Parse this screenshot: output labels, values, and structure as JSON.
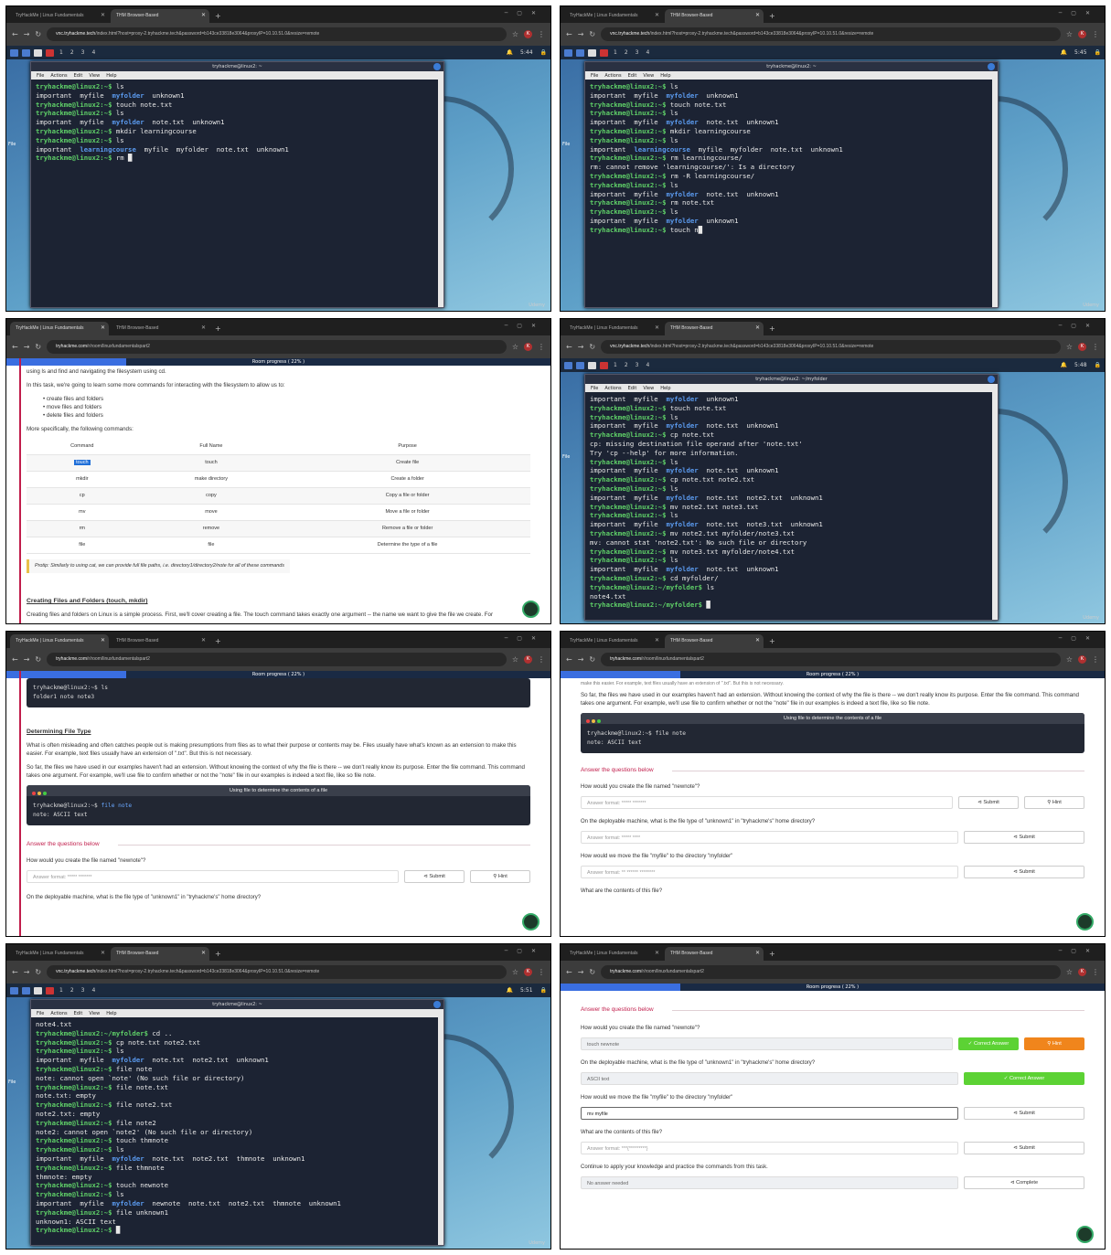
{
  "tabs": {
    "tab1": "TryHackMe | Linux Fundamentals",
    "tab2": "THM Browser-Based",
    "newtab": "+"
  },
  "urls": {
    "vnc_host": "vnc.tryhackme.tech",
    "vnc_rest": "/index.html?host=proxy-2.tryhackme.tech&password=b143ce33818e3064&proxyIP=10.10.51.0&resize=remote",
    "room_host": "tryhackme.com",
    "room_rest": "/r/room/linuxfundamentalspart2"
  },
  "avatar": "K",
  "taskbar": {
    "workspaces": [
      "1",
      "2",
      "3",
      "4"
    ],
    "times": [
      "5:44",
      "5:45",
      "5:48",
      "5:51"
    ]
  },
  "terminal": {
    "title_home": "tryhackme@linux2: ~",
    "title_folder": "tryhackme@linux2: ~/myfolder",
    "menu": [
      "File",
      "Actions",
      "Edit",
      "View",
      "Help"
    ]
  },
  "desktop_label": "File",
  "watermark": "Udemy",
  "progress": "Room progress ( 22% )",
  "term1": [
    {
      "p": "tryhackme@linux2:~$",
      "c": " ls"
    },
    {
      "t": "important  myfile  ",
      "b": "myfolder",
      "t2": "  unknown1"
    },
    {
      "p": "tryhackme@linux2:~$",
      "c": " touch note.txt"
    },
    {
      "p": "tryhackme@linux2:~$",
      "c": " ls"
    },
    {
      "t": "important  myfile  ",
      "b": "myfolder",
      "t2": "  note.txt  unknown1"
    },
    {
      "p": "tryhackme@linux2:~$",
      "c": " mkdir learningcourse"
    },
    {
      "p": "tryhackme@linux2:~$",
      "c": " ls"
    },
    {
      "t": "important  ",
      "b": "learningcourse",
      "t2": "  myfile  myfolder  note.txt  unknown1"
    },
    {
      "p": "tryhackme@linux2:~$",
      "c": " rm █"
    }
  ],
  "term2": [
    {
      "p": "tryhackme@linux2:~$",
      "c": " ls"
    },
    {
      "t": "important  myfile  ",
      "b": "myfolder",
      "t2": "  unknown1"
    },
    {
      "p": "tryhackme@linux2:~$",
      "c": " touch note.txt"
    },
    {
      "p": "tryhackme@linux2:~$",
      "c": " ls"
    },
    {
      "t": "important  myfile  ",
      "b": "myfolder",
      "t2": "  note.txt  unknown1"
    },
    {
      "p": "tryhackme@linux2:~$",
      "c": " mkdir learningcourse"
    },
    {
      "p": "tryhackme@linux2:~$",
      "c": " ls"
    },
    {
      "t": "important  ",
      "b": "learningcourse",
      "t2": "  myfile  myfolder  note.txt  unknown1"
    },
    {
      "p": "tryhackme@linux2:~$",
      "c": " rm learningcourse/"
    },
    {
      "t": "rm: cannot remove 'learningcourse/': Is a directory"
    },
    {
      "p": "tryhackme@linux2:~$",
      "c": " rm -R learningcourse/"
    },
    {
      "p": "tryhackme@linux2:~$",
      "c": " ls"
    },
    {
      "t": "important  myfile  ",
      "b": "myfolder",
      "t2": "  note.txt  unknown1"
    },
    {
      "p": "tryhackme@linux2:~$",
      "c": " rm note.txt"
    },
    {
      "p": "tryhackme@linux2:~$",
      "c": " ls"
    },
    {
      "t": "important  myfile  ",
      "b": "myfolder",
      "t2": "  unknown1"
    },
    {
      "p": "tryhackme@linux2:~$",
      "c": " touch n█"
    }
  ],
  "term4": [
    {
      "t": "important  myfile  ",
      "b": "myfolder",
      "t2": "  unknown1"
    },
    {
      "p": "tryhackme@linux2:~$",
      "c": " touch note.txt"
    },
    {
      "p": "tryhackme@linux2:~$",
      "c": " ls"
    },
    {
      "t": "important  myfile  ",
      "b": "myfolder",
      "t2": "  note.txt  unknown1"
    },
    {
      "p": "tryhackme@linux2:~$",
      "c": " cp note.txt"
    },
    {
      "t": "cp: missing destination file operand after 'note.txt'"
    },
    {
      "t": "Try 'cp --help' for more information."
    },
    {
      "p": "tryhackme@linux2:~$",
      "c": " ls"
    },
    {
      "t": "important  myfile  ",
      "b": "myfolder",
      "t2": "  note.txt  unknown1"
    },
    {
      "p": "tryhackme@linux2:~$",
      "c": " cp note.txt note2.txt"
    },
    {
      "p": "tryhackme@linux2:~$",
      "c": " ls"
    },
    {
      "t": "important  myfile  ",
      "b": "myfolder",
      "t2": "  note.txt  note2.txt  unknown1"
    },
    {
      "p": "tryhackme@linux2:~$",
      "c": " mv note2.txt note3.txt"
    },
    {
      "p": "tryhackme@linux2:~$",
      "c": " ls"
    },
    {
      "t": "important  myfile  ",
      "b": "myfolder",
      "t2": "  note.txt  note3.txt  unknown1"
    },
    {
      "p": "tryhackme@linux2:~$",
      "c": " mv note2.txt myfolder/note3.txt"
    },
    {
      "t": "mv: cannot stat 'note2.txt': No such file or directory"
    },
    {
      "p": "tryhackme@linux2:~$",
      "c": " mv note3.txt myfolder/note4.txt"
    },
    {
      "p": "tryhackme@linux2:~$",
      "c": " ls"
    },
    {
      "t": "important  myfile  ",
      "b": "myfolder",
      "t2": "  note.txt  unknown1"
    },
    {
      "p": "tryhackme@linux2:~$",
      "c": " cd myfolder/"
    },
    {
      "p": "tryhackme@linux2:~/myfolder$",
      "c": " ls"
    },
    {
      "t": "note4.txt"
    },
    {
      "p": "tryhackme@linux2:~/myfolder$",
      "c": " █"
    }
  ],
  "term7": [
    {
      "t": "note4.txt"
    },
    {
      "p": "tryhackme@linux2:~/myfolder$",
      "c": " cd .."
    },
    {
      "p": "tryhackme@linux2:~$",
      "c": " cp note.txt note2.txt"
    },
    {
      "p": "tryhackme@linux2:~$",
      "c": " ls"
    },
    {
      "t": "important  myfile  ",
      "b": "myfolder",
      "t2": "  note.txt  note2.txt  unknown1"
    },
    {
      "p": "tryhackme@linux2:~$",
      "c": " file note"
    },
    {
      "t": "note: cannot open `note' (No such file or directory)"
    },
    {
      "p": "tryhackme@linux2:~$",
      "c": " file note.txt"
    },
    {
      "t": "note.txt: empty"
    },
    {
      "p": "tryhackme@linux2:~$",
      "c": " file note2.txt"
    },
    {
      "t": "note2.txt: empty"
    },
    {
      "p": "tryhackme@linux2:~$",
      "c": " file note2"
    },
    {
      "t": "note2: cannot open `note2' (No such file or directory)"
    },
    {
      "p": "tryhackme@linux2:~$",
      "c": " touch thmnote"
    },
    {
      "p": "tryhackme@linux2:~$",
      "c": " ls"
    },
    {
      "t": "important  myfile  ",
      "b": "myfolder",
      "t2": "  note.txt  note2.txt  thmnote  unknown1"
    },
    {
      "p": "tryhackme@linux2:~$",
      "c": " file thmnote"
    },
    {
      "t": "thmnote: empty"
    },
    {
      "p": "tryhackme@linux2:~$",
      "c": " touch newnote"
    },
    {
      "p": "tryhackme@linux2:~$",
      "c": " ls"
    },
    {
      "t": "important  myfile  ",
      "b": "myfolder",
      "t2": "  newnote  note.txt  note2.txt  thmnote  unknown1"
    },
    {
      "p": "tryhackme@linux2:~$",
      "c": " file unknown1"
    },
    {
      "t": "unknown1: ASCII text"
    },
    {
      "p": "tryhackme@linux2:~$",
      "c": " █"
    }
  ],
  "panel3": {
    "intro_top": "using ls and find and navigating the filesystem using cd.",
    "intro": "In this task, we're going to learn some more commands for interacting with the filesystem to allow us to:",
    "bullets": [
      "create files and folders",
      "move files and folders",
      "delete files and folders"
    ],
    "more": "More specifically, the following commands:",
    "headers": [
      "Command",
      "Full Name",
      "Purpose"
    ],
    "rows": [
      [
        "touch",
        "touch",
        "Create file"
      ],
      [
        "mkdir",
        "make directory",
        "Create a folder"
      ],
      [
        "cp",
        "copy",
        "Copy a file or folder"
      ],
      [
        "mv",
        "move",
        "Move a file or folder"
      ],
      [
        "rm",
        "remove",
        "Remove a file or folder"
      ],
      [
        "file",
        "file",
        "Determine the type of a file"
      ]
    ],
    "protip": "Protip: Similarly to using cat, we can provide full file paths, i.e. directory1/directory2/note for all of these commands",
    "heading": "Creating Files and Folders (touch, mkdir)",
    "bottom": "Creating files and folders on Linux is a simple process. First, we'll cover creating a file. The touch command takes exactly one argument -- the name we want to give the file we create. For"
  },
  "panel5": {
    "code_prompt": "tryhackme@linux2:~$ ls",
    "code_out": "folder1 note note3",
    "heading": "Determining File Type",
    "para1": "What is often misleading and often catches people out is making presumptions from files as to what their purpose or contents may be. Files usually have what's known as an extension to make this easier. For example, text files usually have an extension of \".txt\". But this is not necessary.",
    "para2": "So far, the files we have used in our examples haven't had an extension. Without knowing the context of why the file is there -- we don't really know its purpose. Enter the file command. This command takes one argument. For example, we'll use file to confirm whether or not the \"note\" file in our examples is indeed a text file, like so file note.",
    "code_title": "Using file to determine the contents of a file",
    "code_cmd_prompt": "tryhackme@linux2:~$ ",
    "code_cmd": "file note",
    "code_result": "note: ASCII text",
    "answer_heading": "Answer the questions below",
    "q1": "How would you create the file named \"newnote\"?",
    "q1_placeholder": "Answer format: ***** *******",
    "q2": "On the deployable machine, what is the file type of \"unknown1\" in \"tryhackme's\" home directory?"
  },
  "panel6": {
    "top": "make this easier. For example, text files usually have an extension of \".txt\". But this is not necessary.",
    "para": "So far, the files we have used in our examples haven't had an extension. Without knowing the context of why the file is there -- we don't really know its purpose. Enter the file command. This command takes one argument. For example, we'll use file to confirm whether or not the \"note\" file in our examples is indeed a text file, like so file note.",
    "code_title": "Using file to determine the contents of a file",
    "code_cmd": "tryhackme@linux2:~$ file note",
    "code_result": "note: ASCII text",
    "answer_heading": "Answer the questions below",
    "q1": "How would you create the file named \"newnote\"?",
    "q1_placeholder": "Answer format: ***** *******",
    "q2": "On the deployable machine, what is the file type of \"unknown1\" in \"tryhackme's\" home directory?",
    "q2_placeholder": "Answer format: ***** ****",
    "q3": "How would we move the file \"myfile\" to the directory \"myfolder\"",
    "q3_placeholder": "Answer format: ** ****** ********",
    "q4": "What are the contents of this file?"
  },
  "panel8": {
    "answer_heading": "Answer the questions below",
    "q1": "How would you create the file named \"newnote\"?",
    "a1": "touch newnote",
    "q2": "On the deployable machine, what is the file type of \"unknown1\" in \"tryhackme's\" home directory?",
    "a2": "ASCII text",
    "q3": "How would we move the file \"myfile\" to the directory \"myfolder\"",
    "a3": "mv myfile",
    "q4": "What are the contents of this file?",
    "q4_placeholder": "Answer format: ***{*********}",
    "q5": "Continue to apply your knowledge and practice the commands from this task.",
    "q5_placeholder": "No answer needed"
  },
  "buttons": {
    "submit": "⊲ Submit",
    "hint": "⚲ Hint",
    "correct": "✓ Correct Answer",
    "complete": "⊲ Complete"
  }
}
